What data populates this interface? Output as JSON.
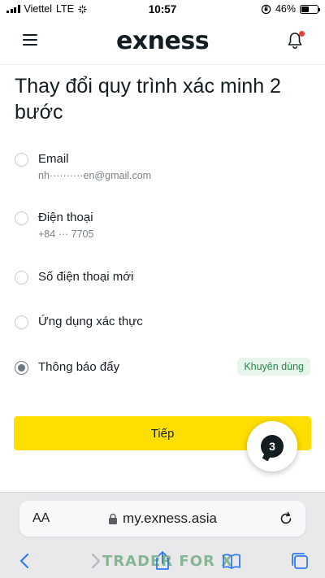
{
  "status_bar": {
    "carrier": "Viettel",
    "network": "LTE",
    "time": "10:57",
    "battery": "46%",
    "battery_level": 0.46
  },
  "header": {
    "logo": "exness",
    "has_notification": true
  },
  "page": {
    "title": "Thay đổi quy trình xác minh 2 bước"
  },
  "options": [
    {
      "label": "Email",
      "sub": "nh··········en@gmail.com",
      "selected": false
    },
    {
      "label": "Điện thoại",
      "sub": "+84 ··· 7705",
      "selected": false
    },
    {
      "label": "Số điện thoại mới",
      "selected": false
    },
    {
      "label": "Ứng dụng xác thực",
      "selected": false
    },
    {
      "label": "Thông báo đẩy",
      "badge": "Khuyên dùng",
      "selected": true
    }
  ],
  "actions": {
    "continue_label": "Tiếp",
    "chat_count": "3"
  },
  "browser": {
    "aa_label": "AA",
    "url": "my.exness.asia"
  },
  "watermark": "TRADER FOR X",
  "colors": {
    "accent_yellow": "#ffde02",
    "badge_bg": "#e8f5ec",
    "badge_text": "#27884a",
    "notification_dot": "#e5413a",
    "browser_blue": "#2f7bf6"
  }
}
